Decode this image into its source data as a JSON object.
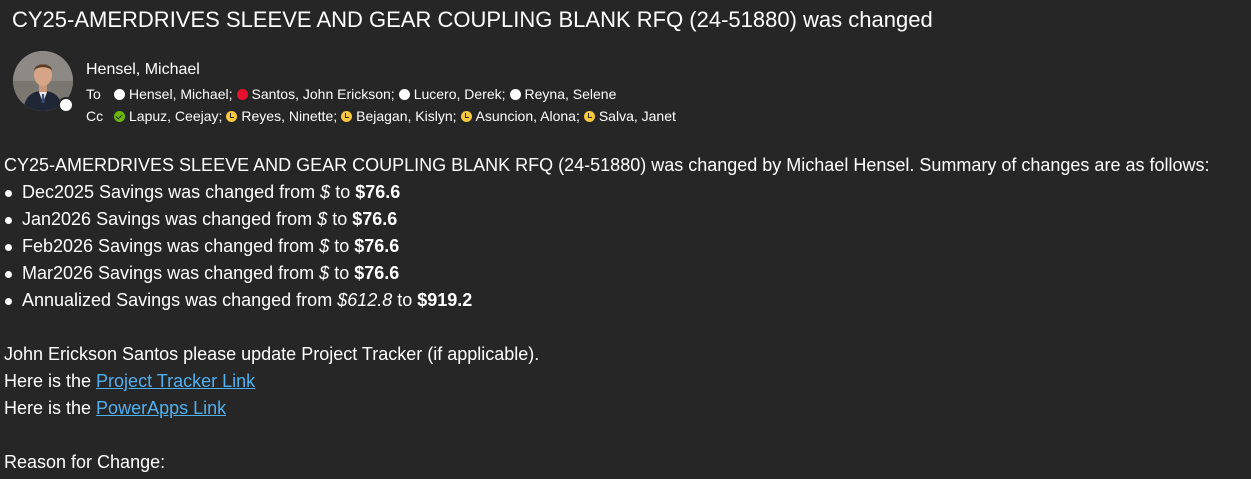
{
  "email": {
    "subject": "CY25-AMERDRIVES SLEEVE AND GEAR COUPLING BLANK RFQ (24-51880) was changed",
    "sender": "Hensel, Michael",
    "to_label": "To",
    "cc_label": "Cc",
    "to": [
      {
        "name": "Hensel, Michael;",
        "status": "available"
      },
      {
        "name": "Santos, John Erickson;",
        "status": "busy"
      },
      {
        "name": "Lucero, Derek;",
        "status": "available"
      },
      {
        "name": "Reyna, Selene",
        "status": "available"
      }
    ],
    "cc": [
      {
        "name": "Lapuz, Ceejay;",
        "status": "online"
      },
      {
        "name": "Reyes, Ninette;",
        "status": "away"
      },
      {
        "name": "Bejagan, Kislyn;",
        "status": "away"
      },
      {
        "name": "Asuncion, Alona;",
        "status": "away"
      },
      {
        "name": "Salva, Janet",
        "status": "away"
      }
    ]
  },
  "body": {
    "intro": "CY25-AMERDRIVES SLEEVE AND GEAR COUPLING BLANK RFQ (24-51880) was changed by Michael Hensel. Summary of changes are as follows:",
    "changes": [
      {
        "prefix": "Dec2025 Savings was changed from ",
        "old": "$",
        "mid": " to ",
        "new": "$76.6"
      },
      {
        "prefix": "Jan2026 Savings was changed from ",
        "old": "$",
        "mid": " to ",
        "new": "$76.6"
      },
      {
        "prefix": "Feb2026 Savings was changed from ",
        "old": "$",
        "mid": " to ",
        "new": "$76.6"
      },
      {
        "prefix": "Mar2026 Savings was changed from ",
        "old": "$",
        "mid": " to ",
        "new": "$76.6"
      },
      {
        "prefix": "Annualized Savings was changed from ",
        "old": "$612.8",
        "mid": " to ",
        "new": "$919.2"
      }
    ],
    "request": "John Erickson Santos please update Project Tracker (if applicable).",
    "link1_prefix": "Here is the ",
    "link1_text": "Project Tracker Link",
    "link2_prefix": "Here is the ",
    "link2_text": "PowerApps Link",
    "reason_label": "Reason for Change:"
  }
}
